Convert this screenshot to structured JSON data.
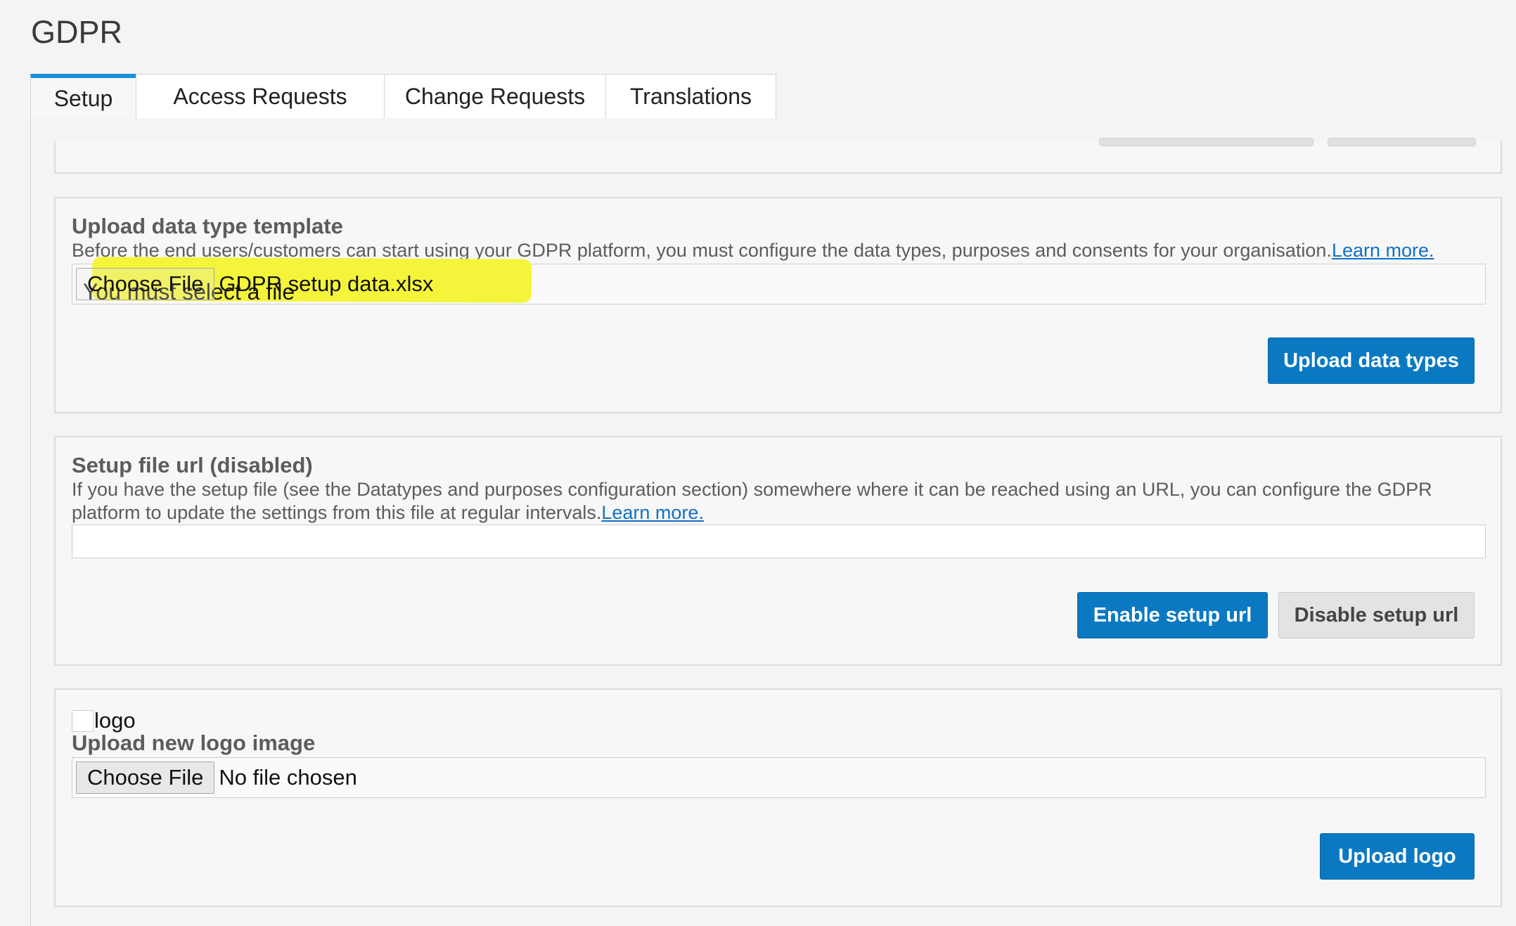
{
  "page": {
    "title": "GDPR"
  },
  "tabs": [
    {
      "label": "Setup",
      "active": true
    },
    {
      "label": "Access Requests",
      "active": false
    },
    {
      "label": "Change Requests",
      "active": false
    },
    {
      "label": "Translations",
      "active": false
    }
  ],
  "upload_section": {
    "heading": "Upload data type template",
    "description": "Before the end users/customers can start using your GDPR platform, you must configure the data types, purposes and consents for your organisation.",
    "learn_more": "Learn more.",
    "choose_file_label": "Choose File",
    "file_name": "GDPR setup data.xlsx",
    "validation_message": "You must select a file",
    "upload_button": "Upload data types",
    "highlight_color": "#f4f53a"
  },
  "url_section": {
    "heading": "Setup file url (disabled)",
    "description": "If you have the setup file (see the Datatypes and purposes configuration section) somewhere where it can be reached using an URL, you can configure the GDPR platform to update the settings from this file at regular intervals.",
    "learn_more": "Learn more.",
    "url_value": "",
    "enable_button": "Enable setup url",
    "disable_button": "Disable setup url"
  },
  "logo_section": {
    "logo_alt": "logo",
    "heading": "Upload new logo image",
    "choose_file_label": "Choose File",
    "file_name": "No file chosen",
    "upload_button": "Upload logo"
  },
  "colors": {
    "primary": "#0a79c2",
    "tab_accent": "#1a90d8",
    "link": "#1270c4"
  }
}
